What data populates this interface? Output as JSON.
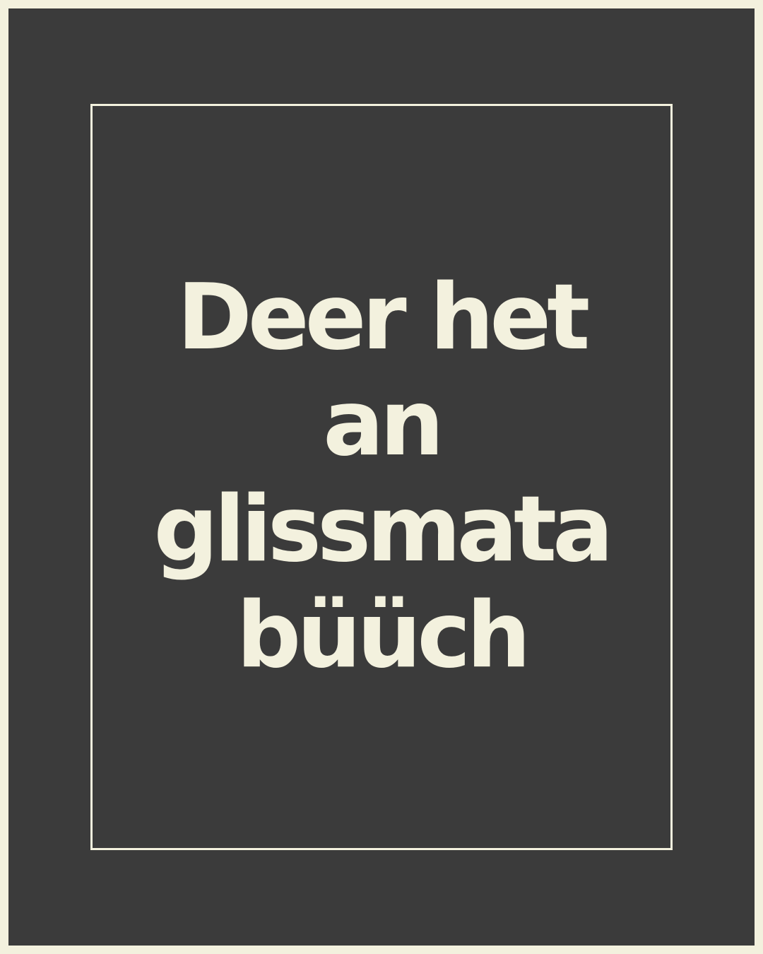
{
  "colors": {
    "background": "#3b3b3b",
    "accent": "#f3f1de"
  },
  "headline": {
    "lines": [
      "Deer het",
      "an",
      "glissmata",
      "büüch"
    ]
  }
}
